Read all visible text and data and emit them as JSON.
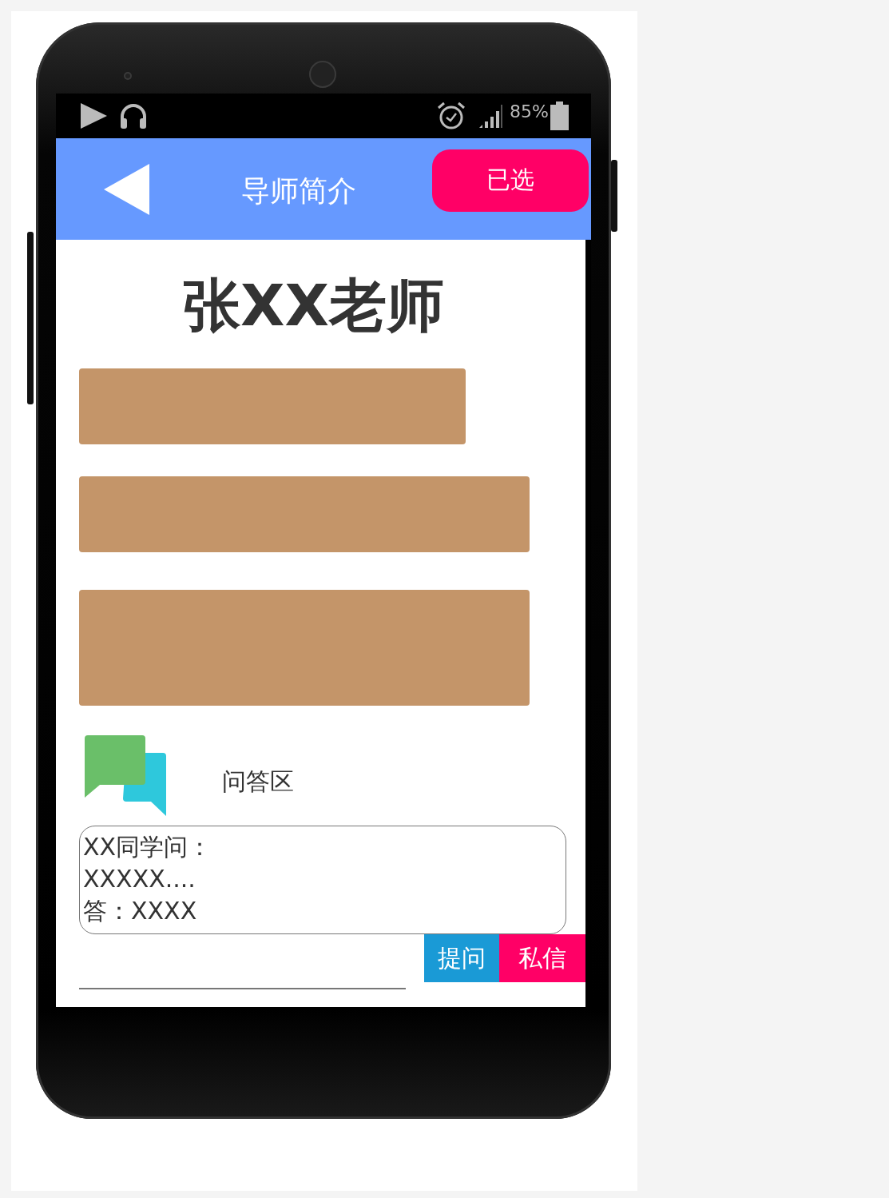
{
  "status_bar": {
    "battery": "85%"
  },
  "header": {
    "title": "导师简介",
    "button": "已选"
  },
  "teacher_name": "张XX老师",
  "info_blocks": [
    {
      "kind": "short"
    },
    {
      "kind": "wide"
    },
    {
      "kind": "tall"
    }
  ],
  "qa": {
    "title": "问答区",
    "lines": [
      "XX同学问：",
      "XXXXX....",
      "答：XXXX"
    ]
  },
  "actions": [
    {
      "label": "提问",
      "kind": "ask"
    },
    {
      "label": "私信",
      "kind": "message"
    }
  ]
}
